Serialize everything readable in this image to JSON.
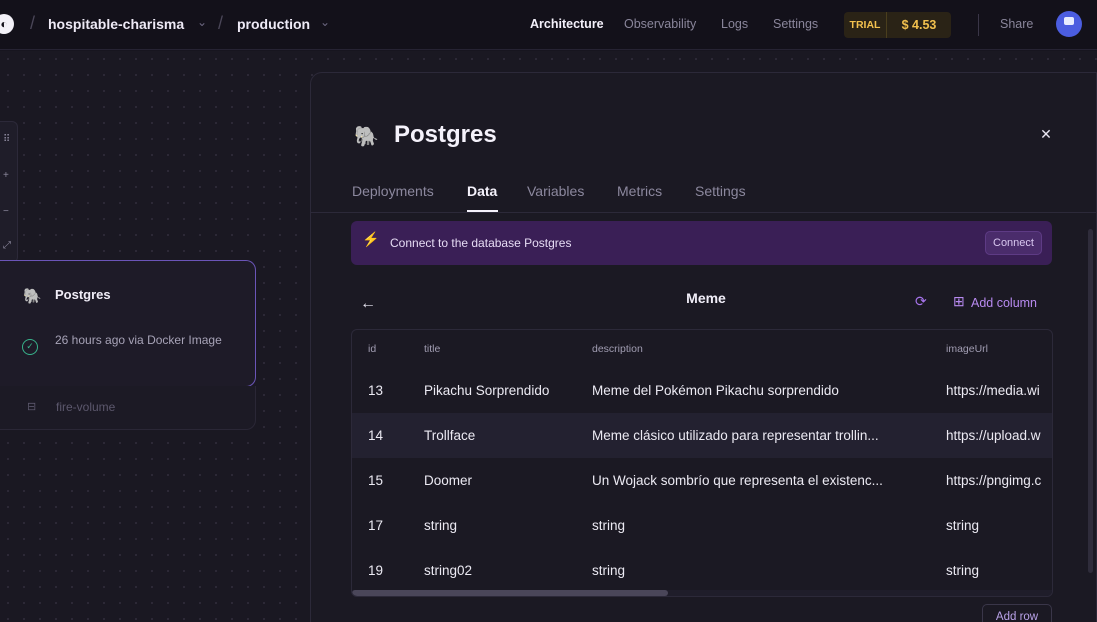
{
  "header": {
    "project": "hospitable-charisma",
    "environment": "production",
    "nav": [
      "Architecture",
      "Observability",
      "Logs",
      "Settings"
    ],
    "active_nav": "Architecture",
    "trial_badge": "TRIAL",
    "credit": "$ 4.53",
    "share_label": "Share"
  },
  "canvas": {
    "service_card": {
      "name": "Postgres",
      "status": "26 hours ago via Docker Image"
    },
    "volume": {
      "label": "fire-volume"
    }
  },
  "panel": {
    "title": "Postgres",
    "tabs": [
      "Deployments",
      "Data",
      "Variables",
      "Metrics",
      "Settings"
    ],
    "active_tab": "Data",
    "connect_banner": {
      "text": "Connect to the database Postgres",
      "button": "Connect"
    },
    "table": {
      "name": "Meme",
      "add_column_label": "Add column",
      "add_row_label": "Add row",
      "columns": [
        "id",
        "title",
        "description",
        "imageUrl"
      ],
      "rows": [
        [
          "13",
          "Pikachu Sorprendido",
          "Meme del Pokémon Pikachu sorprendido",
          "https://media.wi"
        ],
        [
          "14",
          "Trollface",
          "Meme clásico utilizado para representar trollin...",
          "https://upload.w"
        ],
        [
          "15",
          "Doomer",
          "Un Wojack sombrío que representa el existenc...",
          "https://pngimg.c"
        ],
        [
          "17",
          "string",
          "string",
          "string"
        ],
        [
          "19",
          "string02",
          "string",
          "string"
        ]
      ]
    }
  },
  "colors": {
    "accent": "#a774ec",
    "banner": "#3a1f56",
    "trial": "#f2c14e",
    "success": "#38b28b"
  }
}
